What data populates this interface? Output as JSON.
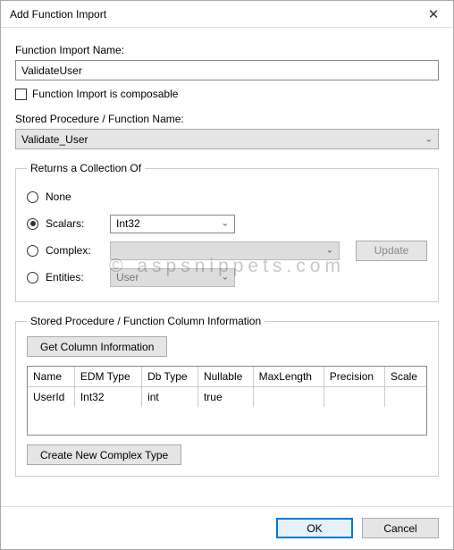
{
  "window": {
    "title": "Add Function Import"
  },
  "fi_name": {
    "label": "Function Import Name:",
    "value": "ValidateUser"
  },
  "composable": {
    "label": "Function Import is composable",
    "checked": false
  },
  "sp_name": {
    "label": "Stored Procedure / Function Name:",
    "value": "Validate_User"
  },
  "returns": {
    "legend": "Returns a Collection Of",
    "none": "None",
    "scalars": {
      "label": "Scalars:",
      "value": "Int32"
    },
    "complex": {
      "label": "Complex:",
      "update_btn": "Update"
    },
    "entities": {
      "label": "Entities:",
      "value": "User"
    },
    "selected": "scalars"
  },
  "col_info": {
    "legend": "Stored Procedure / Function Column Information",
    "get_btn": "Get Column Information",
    "headers": {
      "name": "Name",
      "edm": "EDM Type",
      "db": "Db Type",
      "nullable": "Nullable",
      "maxlen": "MaxLength",
      "precision": "Precision",
      "scale": "Scale"
    },
    "rows": [
      {
        "name": "UserId",
        "edm": "Int32",
        "db": "int",
        "nullable": "true",
        "maxlen": "",
        "precision": "",
        "scale": ""
      }
    ],
    "create_btn": "Create New Complex Type"
  },
  "footer": {
    "ok": "OK",
    "cancel": "Cancel"
  },
  "watermark": "© aspsnippets.com"
}
